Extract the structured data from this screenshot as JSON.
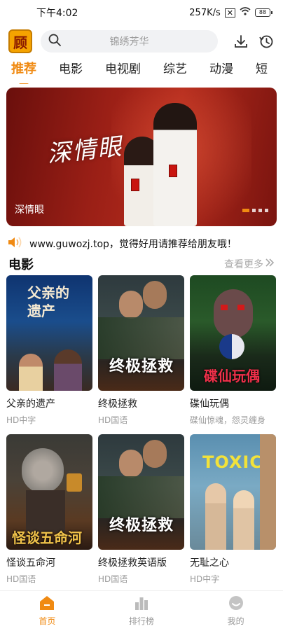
{
  "status_bar": {
    "time": "下午4:02",
    "speed": "257K/s",
    "battery": "88"
  },
  "header": {
    "logo_text": "顾",
    "search_placeholder": "锦绣芳华"
  },
  "tabs": [
    "推荐",
    "电影",
    "电视剧",
    "综艺",
    "动漫",
    "短"
  ],
  "banner": {
    "label": "深情眼",
    "art_title": "深情眼",
    "page_count": 4,
    "active_index": 0
  },
  "notice": {
    "text": "www.guwozj.top，觉得好用请推荐给朋友哦！"
  },
  "section": {
    "title": "电影",
    "more_label": "查看更多"
  },
  "movies": [
    {
      "title": "父亲的遗产",
      "sub": "HD中字",
      "poster_text": "父亲的遗产"
    },
    {
      "title": "终极拯救",
      "sub": "HD国语",
      "poster_text": "终极拯救"
    },
    {
      "title": "碟仙玩偶",
      "sub": "碟仙惊魂，怨灵缠身",
      "poster_text": "碟仙玩偶"
    },
    {
      "title": "怪谈五命河",
      "sub": "HD国语",
      "poster_text": "怪谈五命河"
    },
    {
      "title": "终极拯救英语版",
      "sub": "HD国语",
      "poster_text": "终极拯救"
    },
    {
      "title": "无耻之心",
      "sub": "HD中字",
      "poster_text": "TOXIC"
    }
  ],
  "bottom_nav": [
    {
      "label": "首页",
      "icon": "home-icon",
      "active": true
    },
    {
      "label": "排行榜",
      "icon": "ranking-icon",
      "active": false
    },
    {
      "label": "我的",
      "icon": "profile-icon",
      "active": false
    }
  ],
  "colors": {
    "accent": "#f08a12",
    "muted": "#9a9a9a"
  }
}
